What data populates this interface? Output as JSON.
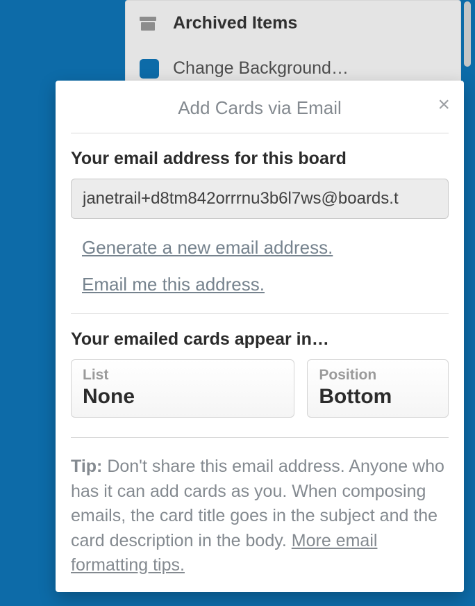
{
  "background_menu": {
    "archived_label": "Archived Items",
    "change_bg_label": "Change Background…"
  },
  "popover": {
    "title": "Add Cards via Email",
    "close_glyph": "×",
    "email_label": "Your email address for this board",
    "email_value": "janetrail+d8tm842orrrnu3b6l7ws@boards.t",
    "links": {
      "generate": "Generate a new email address.",
      "email_me": "Email me this address."
    },
    "appear_label": "Your emailed cards appear in…",
    "list_selector": {
      "label": "List",
      "value": "None"
    },
    "position_selector": {
      "label": "Position",
      "value": "Bottom"
    },
    "tip": {
      "label": "Tip:",
      "body": " Don't share this email address. Anyone who has it can add cards as you. When composing emails, the card title goes in the subject and the card description in the body. ",
      "more_link": "More email formatting tips."
    }
  }
}
